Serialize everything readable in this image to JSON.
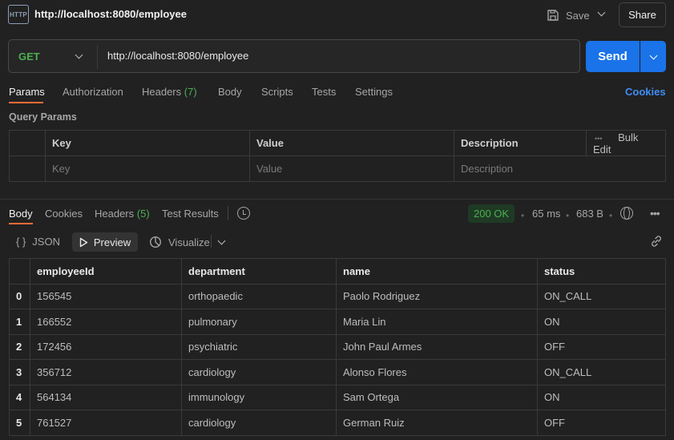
{
  "header": {
    "icon_label": "HTTP",
    "title": "http://localhost:8080/employee",
    "save_label": "Save",
    "share_label": "Share"
  },
  "request": {
    "method": "GET",
    "url": "http://localhost:8080/employee",
    "send_label": "Send"
  },
  "request_tabs": {
    "params": "Params",
    "authorization": "Authorization",
    "headers": "Headers",
    "headers_count": "(7)",
    "body": "Body",
    "scripts": "Scripts",
    "tests": "Tests",
    "settings": "Settings",
    "cookies": "Cookies"
  },
  "query_params": {
    "title": "Query Params",
    "columns": {
      "key": "Key",
      "value": "Value",
      "description": "Description",
      "bulk_edit": "Bulk Edit",
      "more": "•••"
    },
    "placeholders": {
      "key": "Key",
      "value": "Value",
      "description": "Description"
    }
  },
  "response_tabs": {
    "body": "Body",
    "cookies": "Cookies",
    "headers": "Headers",
    "headers_count": "(5)",
    "test_results": "Test Results"
  },
  "response_meta": {
    "status": "200 OK",
    "time": "65 ms",
    "size": "683 B",
    "more": "•••"
  },
  "view_toolbar": {
    "json_icon": "{ }",
    "json_label": "JSON",
    "preview_label": "Preview",
    "visualize_label": "Visualize"
  },
  "response_table": {
    "columns": [
      "employeeId",
      "department",
      "name",
      "status"
    ],
    "rows": [
      {
        "index": "0",
        "employeeId": "156545",
        "department": "orthopaedic",
        "name": "Paolo Rodriguez",
        "status": "ON_CALL"
      },
      {
        "index": "1",
        "employeeId": "166552",
        "department": "pulmonary",
        "name": "Maria Lin",
        "status": "ON"
      },
      {
        "index": "2",
        "employeeId": "172456",
        "department": "psychiatric",
        "name": "John Paul Armes",
        "status": "OFF"
      },
      {
        "index": "3",
        "employeeId": "356712",
        "department": "cardiology",
        "name": "Alonso Flores",
        "status": "ON_CALL"
      },
      {
        "index": "4",
        "employeeId": "564134",
        "department": "immunology",
        "name": "Sam Ortega",
        "status": "ON"
      },
      {
        "index": "5",
        "employeeId": "761527",
        "department": "cardiology",
        "name": "German Ruiz",
        "status": "OFF"
      }
    ]
  },
  "colors": {
    "background": "#212121",
    "accent": "#ff6c37",
    "send_button": "#1a73e8",
    "method_get": "#4caf50",
    "link": "#3e8ef7"
  }
}
